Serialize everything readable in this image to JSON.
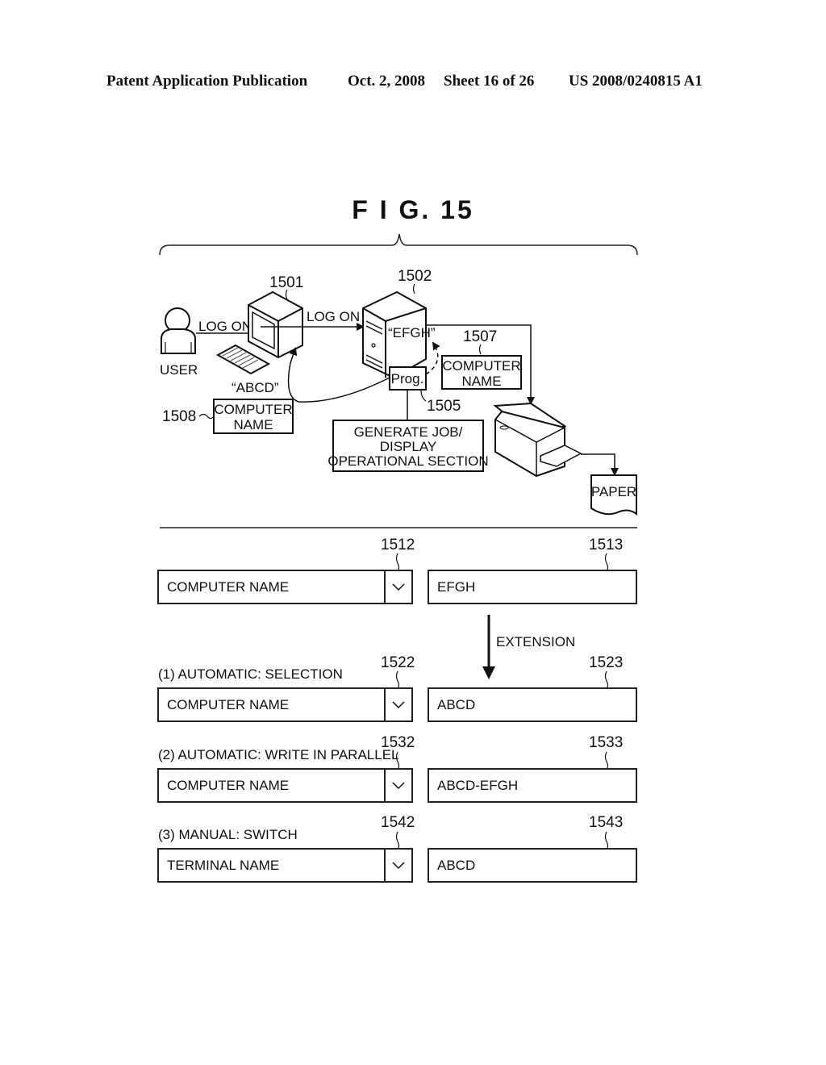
{
  "header": {
    "publication": "Patent Application Publication",
    "date": "Oct. 2, 2008",
    "sheet": "Sheet 16 of 26",
    "number": "US 2008/0240815 A1"
  },
  "figure": {
    "title": "F I G. 15",
    "diagram": {
      "user_label": "USER",
      "log_on_1": "LOG ON",
      "log_on_2": "LOG ON",
      "terminal_ref": "1501",
      "terminal_name": "“ABCD”",
      "server_ref": "1502",
      "server_name": "“EFGH”",
      "prog_label": "Prog.",
      "prog_ref": "1505",
      "server_computer_name_ref": "1507",
      "server_computer_name_line1": "COMPUTER",
      "server_computer_name_line2": "NAME",
      "terminal_computer_name_ref": "1508",
      "terminal_computer_name_line1": "COMPUTER",
      "terminal_computer_name_line2": "NAME",
      "job_box_line1": "GENERATE JOB/",
      "job_box_line2": "DISPLAY",
      "job_box_line3": "OPERATIONAL SECTION",
      "paper_label": "PAPER"
    },
    "settings": {
      "extension_label": "EXTENSION",
      "rows": [
        {
          "caption": "",
          "select_ref": "1512",
          "select_value": "COMPUTER NAME",
          "field_ref": "1513",
          "field_value": "EFGH"
        },
        {
          "caption": "(1) AUTOMATIC:  SELECTION",
          "select_ref": "1522",
          "select_value": "COMPUTER NAME",
          "field_ref": "1523",
          "field_value": "ABCD"
        },
        {
          "caption": "(2) AUTOMATIC:  WRITE IN PARALLEL",
          "select_ref": "1532",
          "select_value": "COMPUTER NAME",
          "field_ref": "1533",
          "field_value": "ABCD-EFGH"
        },
        {
          "caption": "(3) MANUAL:  SWITCH",
          "select_ref": "1542",
          "select_value": "TERMINAL NAME",
          "field_ref": "1543",
          "field_value": "ABCD"
        }
      ]
    }
  }
}
